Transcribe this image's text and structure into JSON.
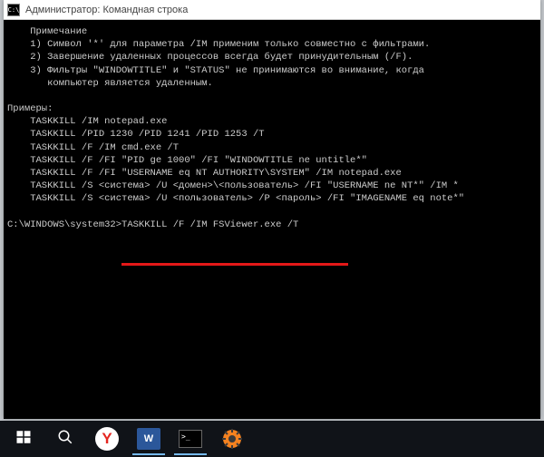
{
  "window": {
    "title": "Администратор: Командная строка",
    "icon_glyph": "C:\\"
  },
  "console": {
    "note_heading": "    Примечание",
    "note_lines": [
      "    1) Символ '*' для параметра /IM применим только совместно с фильтрами.",
      "    2) Завершение удаленных процессов всегда будет принудительным (/F).",
      "    3) Фильтры \"WINDOWTITLE\" и \"STATUS\" не принимаются во внимание, когда",
      "       компьютер является удаленным."
    ],
    "examples_heading": "Примеры:",
    "examples_lines": [
      "    TASKKILL /IM notepad.exe",
      "    TASKKILL /PID 1230 /PID 1241 /PID 1253 /T",
      "    TASKKILL /F /IM cmd.exe /T",
      "    TASKKILL /F /FI \"PID ge 1000\" /FI \"WINDOWTITLE ne untitle*\"",
      "    TASKKILL /F /FI \"USERNAME eq NT AUTHORITY\\SYSTEM\" /IM notepad.exe",
      "    TASKKILL /S <система> /U <домен>\\<пользователь> /FI \"USERNAME ne NT*\" /IM *",
      "    TASKKILL /S <система> /U <пользователь> /P <пароль> /FI \"IMAGENAME eq note*\""
    ],
    "prompt_path": "C:\\WINDOWS\\system32>",
    "prompt_command": "TASKKILL /F /IM FSViewer.exe /T"
  },
  "taskbar": {
    "start": "start-menu",
    "search": "search",
    "yandex_label": "Y",
    "word_label": "W",
    "cmd_glyph": ">_",
    "gear": "settings"
  },
  "annotation": {
    "underline_color": "#e41818"
  }
}
